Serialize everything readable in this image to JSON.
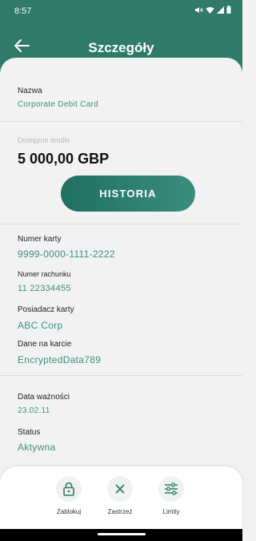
{
  "status_bar": {
    "time": "8:57"
  },
  "header": {
    "title": "Szczegóły"
  },
  "card": {
    "name_label": "Nazwa",
    "name_value": "Corporate Debit Card",
    "available_label": "Dostępne środki",
    "available_value": "5 000,00 GBP",
    "history_button": "HISTORIA"
  },
  "details": {
    "card_number_label": "Numer karty",
    "card_number_value": "9999-0000-1111-2222",
    "account_number_label": "Numer rachunku",
    "account_number_value": "11 22334455",
    "holder_label": "Posiadacz karty",
    "holder_value": "ABC Corp",
    "card_data_label": "Dane na karcie",
    "card_data_value": "EncryptedData789",
    "expiry_label": "Data ważności",
    "expiry_value": "23.02.11",
    "status_label": "Status",
    "status_value": "Aktywna"
  },
  "actions": [
    {
      "label": "Zablokuj",
      "icon": "lock-icon"
    },
    {
      "label": "Zastrzeż",
      "icon": "close-icon"
    },
    {
      "label": "Limity",
      "icon": "sliders-icon"
    }
  ],
  "colors": {
    "primary": "#2f7a68",
    "accent_text": "#3b8f80",
    "background": "#f2f2f2"
  }
}
